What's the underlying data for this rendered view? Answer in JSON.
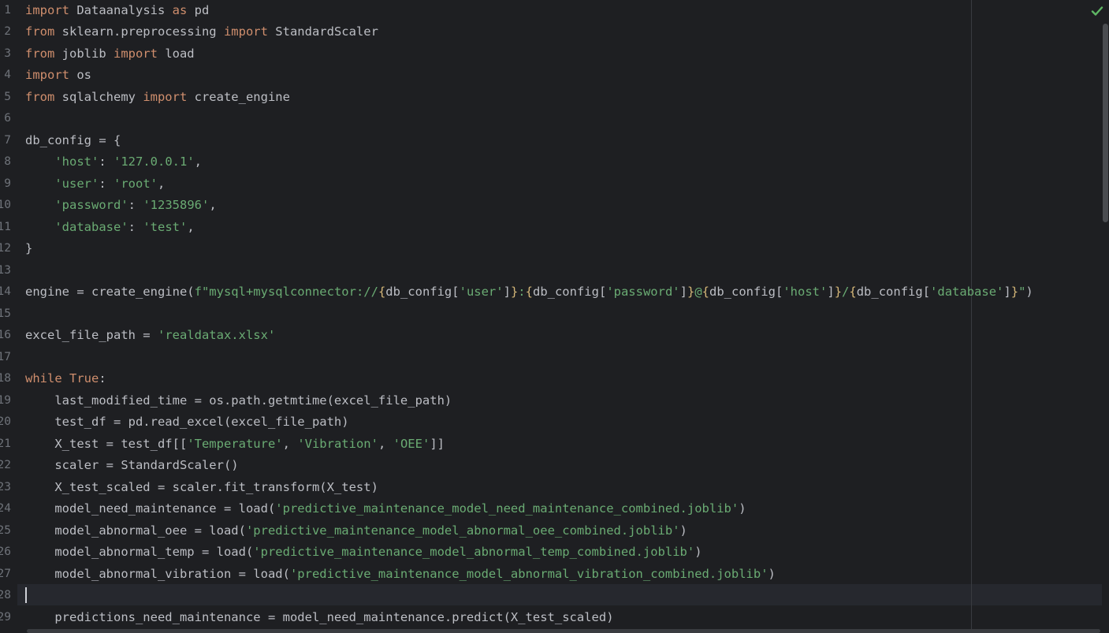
{
  "editor": {
    "line_numbers": [
      "1",
      "2",
      "3",
      "4",
      "5",
      "6",
      "7",
      "8",
      "9",
      "10",
      "11",
      "12",
      "13",
      "14",
      "15",
      "16",
      "17",
      "18",
      "19",
      "20",
      "21",
      "22",
      "23",
      "24",
      "25",
      "26",
      "27",
      "28",
      "29"
    ],
    "status_icon": "checkmark-icon",
    "status_color": "#5fb865"
  },
  "code": {
    "l1": {
      "a": "import",
      "b": " Dataanalysis ",
      "c": "as",
      "d": " pd"
    },
    "l2": {
      "a": "from",
      "b": " sklearn.preprocessing ",
      "c": "import",
      "d": " StandardScaler"
    },
    "l3": {
      "a": "from",
      "b": " joblib ",
      "c": "import",
      "d": " load"
    },
    "l4": {
      "a": "import",
      "b": " os"
    },
    "l5": {
      "a": "from",
      "b": " sqlalchemy ",
      "c": "import",
      "d": " create_engine"
    },
    "l7": {
      "a": "db_config = {"
    },
    "l8": {
      "a": "    ",
      "b": "'host'",
      "c": ": ",
      "d": "'127.0.0.1'",
      "e": ","
    },
    "l9": {
      "a": "    ",
      "b": "'user'",
      "c": ": ",
      "d": "'root'",
      "e": ","
    },
    "l10": {
      "a": "    ",
      "b": "'password'",
      "c": ": ",
      "d": "'1235896'",
      "e": ","
    },
    "l11": {
      "a": "    ",
      "b": "'database'",
      "c": ": ",
      "d": "'test'",
      "e": ","
    },
    "l12": {
      "a": "}"
    },
    "l14": {
      "p1": "engine = create_engine(",
      "p2": "f\"mysql+mysqlconnector://",
      "p3": "{",
      "p4": "db_config[",
      "p5": "'user'",
      "p6": "]",
      "p7": "}",
      "p8": ":",
      "p9": "{",
      "p10": "db_config[",
      "p11": "'password'",
      "p12": "]",
      "p13": "}",
      "p14": "@",
      "p15": "{",
      "p16": "db_config[",
      "p17": "'host'",
      "p18": "]",
      "p19": "}",
      "p20": "/",
      "p21": "{",
      "p22": "db_config[",
      "p23": "'database'",
      "p24": "]",
      "p25": "}",
      "p26": "\"",
      "p27": ")"
    },
    "l16": {
      "a": "excel_file_path = ",
      "b": "'realdatax.xlsx'"
    },
    "l18": {
      "a": "while",
      "b": " ",
      "c": "True",
      "d": ":"
    },
    "l19": {
      "a": "    last_modified_time = os.path.getmtime(excel_file_path)"
    },
    "l20": {
      "a": "    test_df = pd.read_excel(excel_file_path)"
    },
    "l21": {
      "a": "    X_test = test_df[[",
      "b": "'Temperature'",
      "c": ", ",
      "d": "'Vibration'",
      "e": ", ",
      "f": "'OEE'",
      "g": "]]"
    },
    "l22": {
      "a": "    scaler = StandardScaler()"
    },
    "l23": {
      "a": "    X_test_scaled = scaler.fit_transform(X_test)"
    },
    "l24": {
      "a": "    model_need_maintenance = load(",
      "b": "'predictive_maintenance_model_need_maintenance_combined.joblib'",
      "c": ")"
    },
    "l25": {
      "a": "    model_abnormal_oee = load(",
      "b": "'predictive_maintenance_model_abnormal_oee_combined.joblib'",
      "c": ")"
    },
    "l26": {
      "a": "    model_abnormal_temp = load(",
      "b": "'predictive_maintenance_model_abnormal_temp_combined.joblib'",
      "c": ")"
    },
    "l27": {
      "a": "    model_abnormal_vibration = load(",
      "b": "'predictive_maintenance_model_abnormal_vibration_combined.joblib'",
      "c": ")"
    },
    "l29": {
      "a": "    predictions_need_maintenance = model_need_maintenance.predict(X_test_scaled)"
    }
  }
}
